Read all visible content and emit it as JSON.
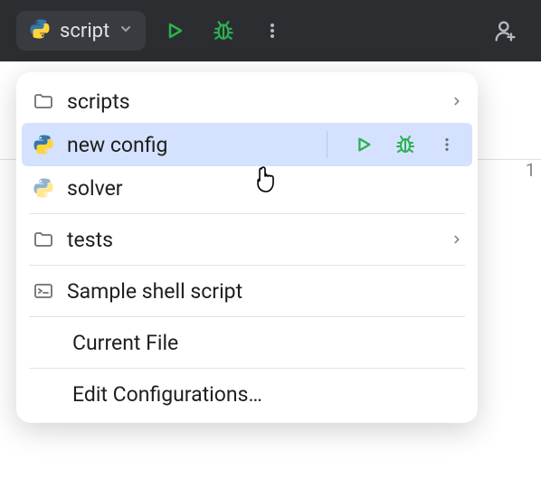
{
  "toolbar": {
    "selected_config": "script"
  },
  "side_number": "1",
  "menu": {
    "scripts_folder": "scripts",
    "new_config": "new config",
    "solver": "solver",
    "tests_folder": "tests",
    "sample_shell": "Sample shell script",
    "current_file": "Current File",
    "edit_configs": "Edit Configurations…"
  },
  "colors": {
    "accent_green": "#2bb150",
    "icon_gray": "#6e6e6e",
    "toolbar_icon": "#b4b8bf",
    "selected_bg": "#d4e2ff"
  }
}
